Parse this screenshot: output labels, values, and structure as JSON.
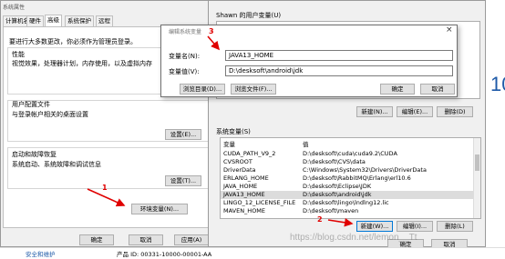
{
  "sysprops": {
    "title": "系统属性",
    "tabs": [
      "计算机名",
      "硬件",
      "高级",
      "系统保护",
      "远程"
    ],
    "notice": "要进行大多数更改，你必须作为管理员登录。",
    "perf_title": "性能",
    "perf_desc": "视觉效果，处理器计划，内存使用，以及虚拟内存",
    "profile_title": "用户配置文件",
    "profile_desc": "与登录帐户相关的桌面设置",
    "settings_label": "设置(E)...",
    "startup_title": "启动和故障恢复",
    "startup_desc": "系统启动、系统故障和调试信息",
    "settings2_label": "设置(T)...",
    "env_button": "环境变量(N)...",
    "ok": "确定",
    "cancel": "取消",
    "apply": "应用(A)"
  },
  "envwin": {
    "user_vars_title": "Shawn 的用户变量(U)",
    "new_label": "新建(N)...",
    "edit_label": "编辑(E)...",
    "delete_label": "删除(D)",
    "system_vars_title": "系统变量(S)",
    "col_var": "变量",
    "col_val": "值",
    "rows": [
      {
        "name": "CUDA_PATH_V9_2",
        "value": "D:\\desksoft\\cuda\\cuda9.2\\CUDA"
      },
      {
        "name": "CVSROOT",
        "value": "D:\\desksoft\\CVS\\data"
      },
      {
        "name": "DriverData",
        "value": "C:\\Windows\\System32\\Drivers\\DriverData"
      },
      {
        "name": "ERLANG_HOME",
        "value": "D:\\desksoft\\RabbitMQ\\Erlang\\erl10.6"
      },
      {
        "name": "JAVA_HOME",
        "value": "D:\\desksoft\\Eclipse\\JDK"
      },
      {
        "name": "JAVA13_HOME",
        "value": "D:\\desksoft\\android\\jdk"
      },
      {
        "name": "LINGO_12_LICENSE_FILE",
        "value": "D:\\desksoft\\lingo\\lndlng12.lic"
      },
      {
        "name": "MAVEN_HOME",
        "value": "D:\\desksoft\\maven"
      }
    ],
    "new2_label": "新建(W)...",
    "edit2_label": "编辑(I)...",
    "delete2_label": "删除(L)",
    "ok": "确定",
    "cancel": "取消"
  },
  "editdlg": {
    "title": "编辑系统变量",
    "name_label": "变量名(N):",
    "name_value": "JAVA13_HOME",
    "value_label": "变量值(V):",
    "value_value": "D:\\desksoft\\android\\jdk",
    "browse_dir": "浏览目录(D)...",
    "browse_file": "浏览文件(F)...",
    "ok": "确定",
    "cancel": "取消"
  },
  "annotations": {
    "a1": "1",
    "a2": "2",
    "a3": "3"
  },
  "taskbar": {
    "left_text": "安全和维护",
    "product_id": "产品 ID: 00331-10000-00001-AA",
    "watermark": "https://blog.csdn.net/lemon__Tt"
  },
  "bg_fragment": "10",
  "colors": {
    "arrow": "#e00000",
    "focus": "#0078d7"
  }
}
